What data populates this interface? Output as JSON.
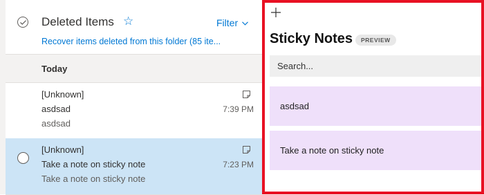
{
  "mail": {
    "folder_title": "Deleted Items",
    "filter_label": "Filter",
    "recover_link": "Recover items deleted from this folder (85 ite...",
    "group_label": "Today",
    "messages": [
      {
        "sender": "[Unknown]",
        "subject": "asdsad",
        "preview": "asdsad",
        "time": "7:39 PM",
        "selected": false
      },
      {
        "sender": "[Unknown]",
        "subject": "Take a note on sticky note",
        "preview": "Take a note on sticky note",
        "time": "7:23 PM",
        "selected": true
      }
    ]
  },
  "sticky": {
    "title": "Sticky Notes",
    "badge": "PREVIEW",
    "search_placeholder": "Search...",
    "notes": [
      {
        "text": "asdsad"
      },
      {
        "text": "Take a note on sticky note"
      }
    ]
  },
  "colors": {
    "accent": "#0078d4",
    "selected_row": "#cce4f6",
    "note_card": "#efe0fa",
    "highlight_frame": "#e81123"
  },
  "icons": {
    "select_all": "checkmark-circle-icon",
    "favorite": "star-icon",
    "filter": "chevron-down-icon",
    "message_type": "sticky-note-icon",
    "add_note": "plus-icon"
  }
}
